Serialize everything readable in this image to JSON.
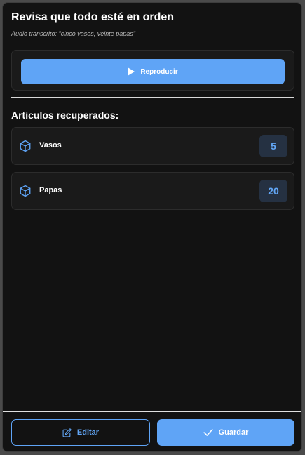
{
  "header": {
    "title": "Revisa que todo esté en orden",
    "transcript": "Audio transcrito: \"cinco vasos, veinte papas\""
  },
  "audio": {
    "play_label": "Reproducir",
    "play_icon": "play-icon"
  },
  "items_section": {
    "title": "Articulos recuperados:",
    "items": [
      {
        "icon": "package-icon",
        "name": "Vasos",
        "quantity": "5"
      },
      {
        "icon": "package-icon",
        "name": "Papas",
        "quantity": "20"
      }
    ]
  },
  "footer": {
    "edit_label": "Editar",
    "edit_icon": "edit-icon",
    "save_label": "Guardar",
    "save_icon": "check-icon"
  },
  "colors": {
    "accent": "#5fa4f6",
    "background": "#121212",
    "card": "#1a1a1a",
    "badge_bg": "#253142"
  }
}
